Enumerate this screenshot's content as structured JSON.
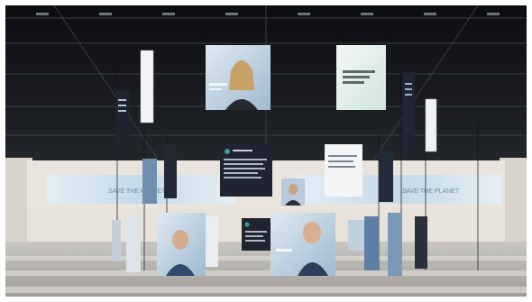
{
  "scene": {
    "type": "photograph",
    "subject": "exhibition hall with suspended digital display screens",
    "colors": {
      "ceiling": "#141619",
      "floor": "#b9b6b1",
      "floor_stripe": "#d9d6d1",
      "side_wall": "#ded9d1",
      "led_wall": "#cfe0ec",
      "screen_frame": "#f2f2f2",
      "dark_panel": "#1f2430",
      "accent_teal": "#3a9e9b"
    }
  },
  "signs": {
    "led_wall_left": "SAVE THE PLANET",
    "led_wall_right": "SAVE THE PLANET"
  }
}
